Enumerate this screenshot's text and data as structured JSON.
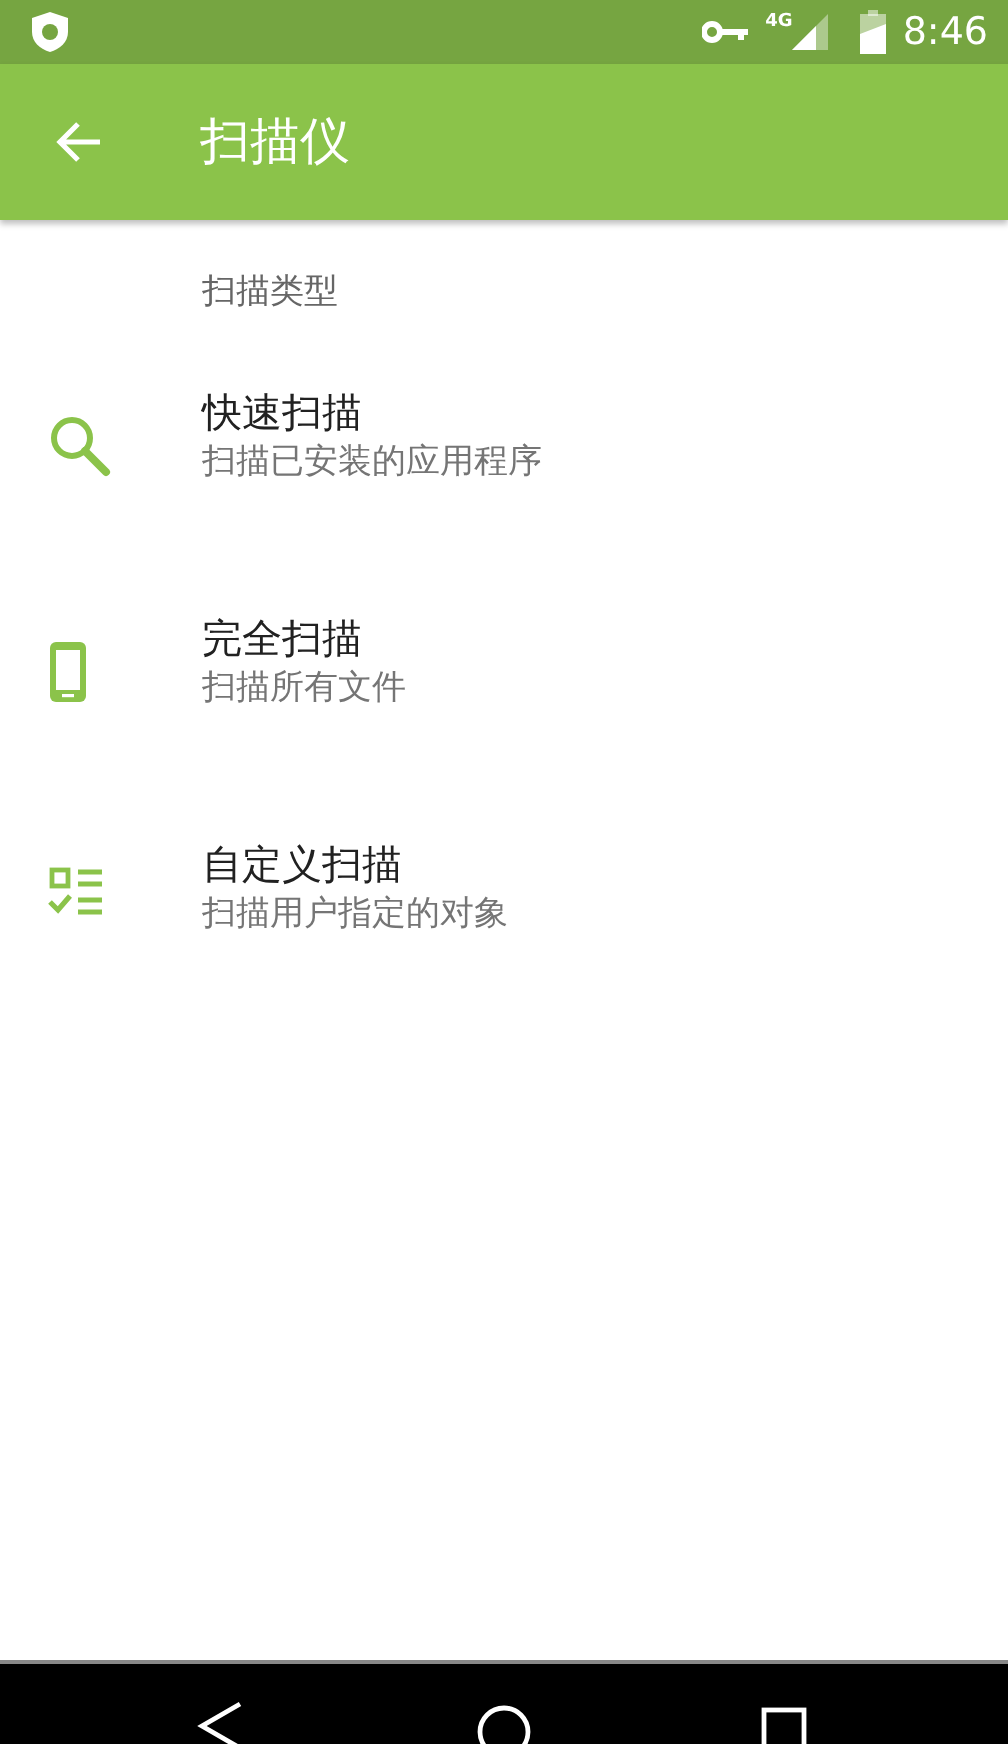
{
  "status_bar": {
    "time": "8:46",
    "network": "4G"
  },
  "toolbar": {
    "title": "扫描仪"
  },
  "section": {
    "header": "扫描类型"
  },
  "items": [
    {
      "kind": "quick",
      "title": "快速扫描",
      "subtitle": "扫描已安装的应用程序"
    },
    {
      "kind": "full",
      "title": "完全扫描",
      "subtitle": "扫描所有文件"
    },
    {
      "kind": "custom",
      "title": "自定义扫描",
      "subtitle": "扫描用户指定的对象"
    }
  ]
}
